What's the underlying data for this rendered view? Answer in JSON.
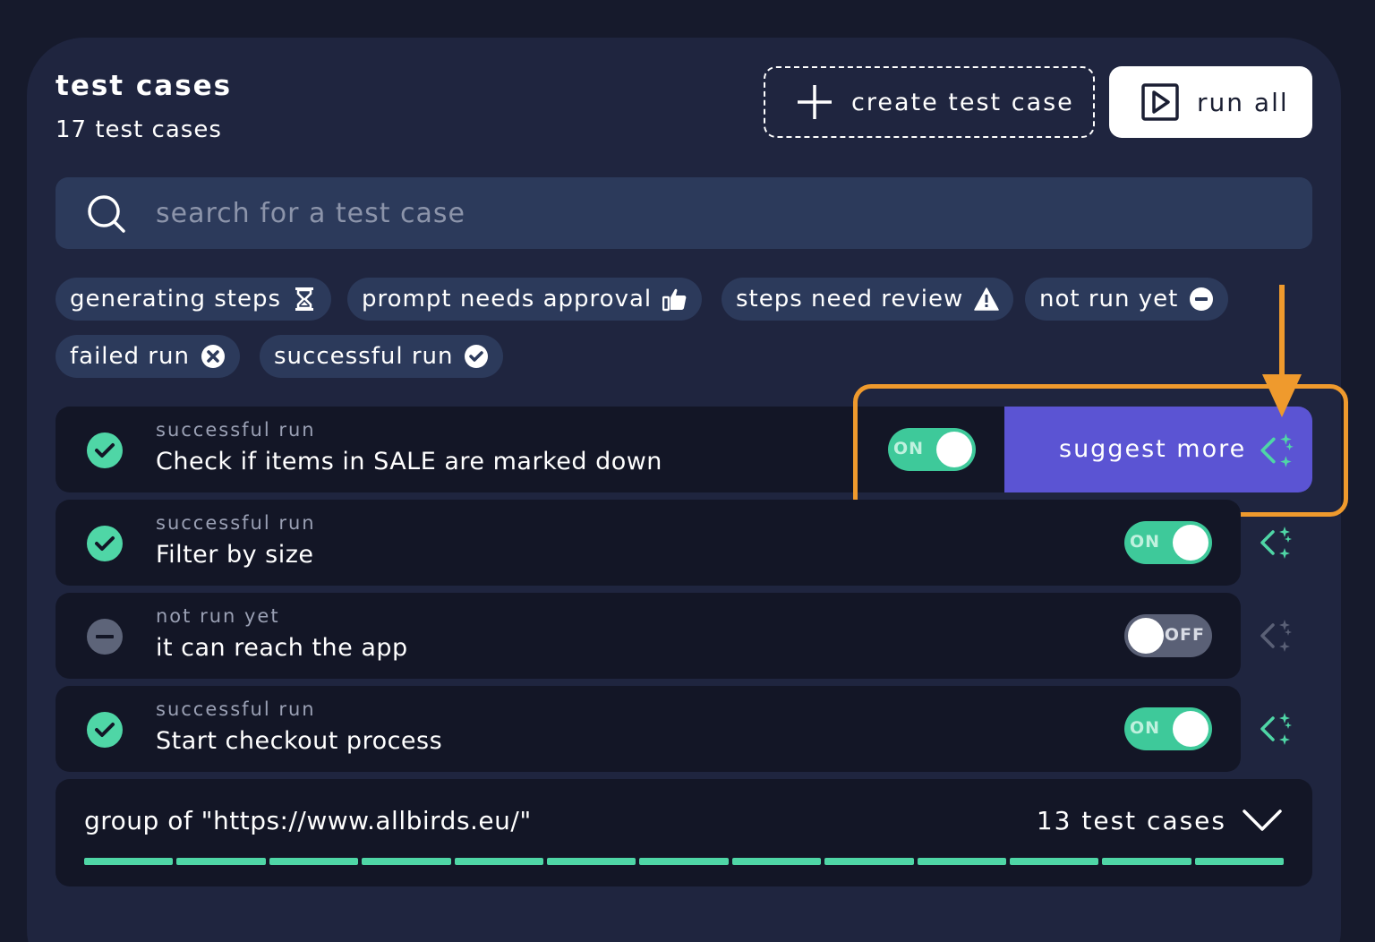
{
  "header": {
    "title": "test cases",
    "subtitle": "17 test cases",
    "create_label": "create test case",
    "run_all_label": "run all"
  },
  "search": {
    "placeholder": "search for a test case"
  },
  "filters": [
    {
      "label": "generating steps",
      "icon": "hourglass-icon"
    },
    {
      "label": "prompt needs approval",
      "icon": "thumbs-up-icon"
    },
    {
      "label": "steps need review",
      "icon": "warning-icon"
    },
    {
      "label": "not run yet",
      "icon": "minus-circle-icon"
    },
    {
      "label": "failed run",
      "icon": "x-circle-icon"
    },
    {
      "label": "successful run",
      "icon": "check-circle-icon"
    }
  ],
  "test_cases": [
    {
      "status": "successful run",
      "title": "Check if items in SALE are marked down",
      "toggle": "ON",
      "suggest_label": "suggest more"
    },
    {
      "status": "successful run",
      "title": "Filter by size",
      "toggle": "ON"
    },
    {
      "status": "not run yet",
      "title": "it can reach the app",
      "toggle": "OFF"
    },
    {
      "status": "successful run",
      "title": "Start checkout process",
      "toggle": "ON"
    }
  ],
  "group": {
    "label": "group of \"https://www.allbirds.eu/\"",
    "count": "13 test cases",
    "progress": 1.0
  },
  "colors": {
    "success": "#4fd6a6",
    "accent": "#5b54d3",
    "highlight": "#ef9a2d",
    "panel": "#1f253f"
  }
}
